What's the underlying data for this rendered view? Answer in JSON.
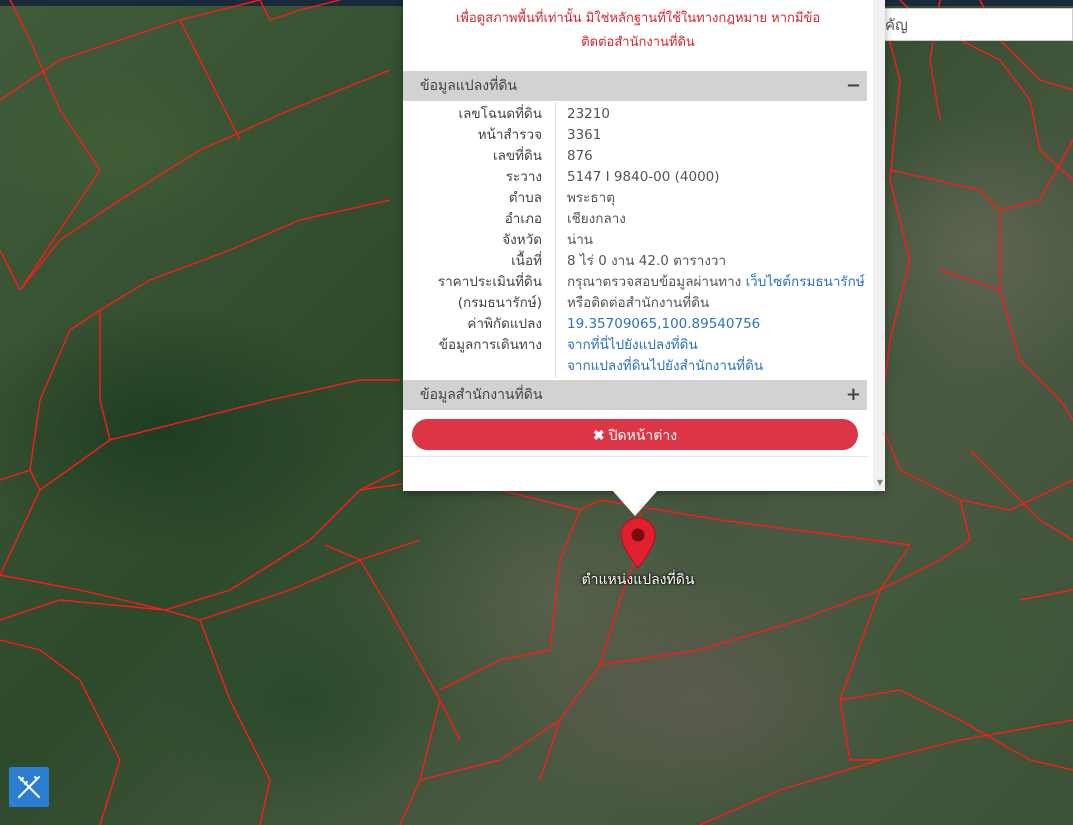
{
  "search": {
    "placeholder": "ค้นหาสถานที่สำคัญ"
  },
  "disclaimer": {
    "line1": "เพื่อดูสภาพพื้นที่เท่านั้น มิใช่หลักฐานที่ใช้ในทางกฎหมาย หากมีข้อ",
    "line2": "ติดต่อสำนักงานที่ดิน"
  },
  "land_panel": {
    "title": "ข้อมูลแปลงที่ดิน",
    "toggle": "−",
    "rows": [
      {
        "label": "เลขโฉนดที่ดิน",
        "value": "23210"
      },
      {
        "label": "หน้าสำรวจ",
        "value": "3361"
      },
      {
        "label": "เลขที่ดิน",
        "value": "876"
      },
      {
        "label": "ระวาง",
        "value": "5147 I 9840-00 (4000)"
      },
      {
        "label": "ตำบล",
        "value": "พระธาตุ"
      },
      {
        "label": "อำเภอ",
        "value": "เชียงกลาง"
      },
      {
        "label": "จังหวัด",
        "value": "น่าน"
      },
      {
        "label": "เนื้อที่",
        "value": "8 ไร่ 0 งาน 42.0 ตารางวา"
      }
    ],
    "appraisal": {
      "label1": "ราคาประเมินที่ดิน",
      "label2": "(กรมธนารักษ์)",
      "value_text": "กรุณาตรวจสอบข้อมูลผ่านทาง",
      "value_link": "เว็บไซต์กรมธนารักษ์",
      "value_line2": "หรือติดต่อสำนักงานที่ดิน"
    },
    "coordinates": {
      "label": "ค่าพิกัดแปลง",
      "value": "19.35709065,100.89540756"
    },
    "directions": {
      "label": "ข้อมูลการเดินทาง",
      "link1": "จากที่นี่ไปยังแปลงที่ดิน",
      "link2": "จากแปลงที่ดินไปยังสำนักงานที่ดิน"
    }
  },
  "office_panel": {
    "title": "ข้อมูลสำนักงานที่ดิน",
    "toggle": "+"
  },
  "close_button": {
    "icon": "✖",
    "label": "ปิดหน้าต่าง"
  },
  "marker": {
    "label": "ตำแหน่งแปลงที่ดิน",
    "color": "#e0202e"
  },
  "colors": {
    "parcel_line": "#ff1a1a",
    "close_button": "#dc3545",
    "link": "#2a73c4",
    "tool_button": "#2a7fd4"
  }
}
